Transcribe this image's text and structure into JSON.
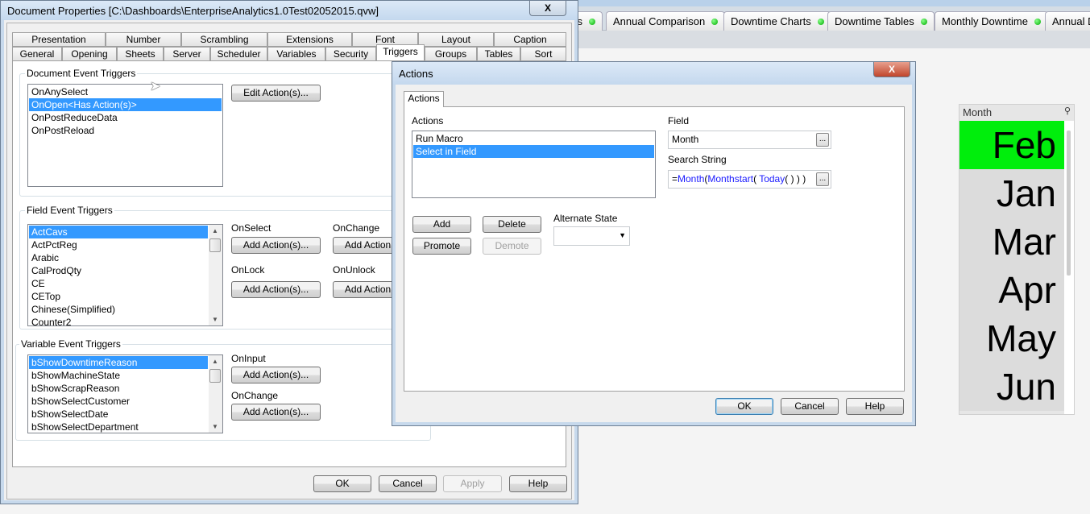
{
  "app": {
    "sheet_tabs": [
      {
        "label": "Annual Comparison"
      },
      {
        "label": "Downtime Charts"
      },
      {
        "label": "Downtime Tables"
      },
      {
        "label": "Monthly Downtime"
      },
      {
        "label": "Annual D"
      }
    ],
    "partial_tab": "s"
  },
  "doc_props": {
    "title": "Document Properties [C:\\Dashboards\\EnterpriseAnalytics1.0Test02052015.qvw]",
    "close": "X",
    "tabs_row1": [
      "Presentation",
      "Number",
      "Scrambling",
      "Extensions",
      "Font",
      "Layout",
      "Caption"
    ],
    "tabs_row2": [
      "General",
      "Opening",
      "Sheets",
      "Server",
      "Scheduler",
      "Variables",
      "Security",
      "Triggers",
      "Groups",
      "Tables",
      "Sort"
    ],
    "selected_tab": "Triggers",
    "document_triggers": {
      "label": "Document Event Triggers",
      "items": [
        "OnAnySelect",
        "OnOpen<Has Action(s)>",
        "OnPostReduceData",
        "OnPostReload"
      ],
      "selected": 1,
      "edit_button": "Edit Action(s)..."
    },
    "field_triggers": {
      "label": "Field Event Triggers",
      "items": [
        "ActCavs",
        "ActPctReg",
        "Arabic",
        "CalProdQty",
        "CE",
        "CETop",
        "Chinese(Simplified)",
        "Counter2"
      ],
      "selected": 0,
      "on_select": "OnSelect",
      "on_change": "OnChange",
      "on_lock": "OnLock",
      "on_unlock": "OnUnlock",
      "add_button": "Add Action(s)..."
    },
    "variable_triggers": {
      "label": "Variable Event Triggers",
      "items": [
        "bShowDowntimeReason",
        "bShowMachineState",
        "bShowScrapReason",
        "bShowSelectCustomer",
        "bShowSelectDate",
        "bShowSelectDepartment"
      ],
      "selected": 0,
      "on_input": "OnInput",
      "on_change": "OnChange",
      "add_button": "Add Action(s)..."
    },
    "buttons": {
      "ok": "OK",
      "cancel": "Cancel",
      "apply": "Apply",
      "help": "Help"
    }
  },
  "actions_dialog": {
    "title": "Actions",
    "close": "X",
    "tab": "Actions",
    "actions_label": "Actions",
    "actions": [
      "Run Macro",
      "Select in Field"
    ],
    "selected": 1,
    "field_label": "Field",
    "field_value": "Month",
    "search_label": "Search String",
    "search_parts": {
      "eq": "=",
      "f1": "Month",
      "p1": "(",
      "f2": "Monthstart",
      "p2": "( ",
      "f3": "Today",
      "p3": "( ) ) )"
    },
    "ellipsis": "...",
    "add": "Add",
    "delete": "Delete",
    "promote": "Promote",
    "demote": "Demote",
    "alt_state_label": "Alternate State",
    "alt_state_value": "",
    "ok": "OK",
    "cancel": "Cancel",
    "help": "Help"
  },
  "listbox": {
    "title": "Month",
    "items": [
      "Feb",
      "Jan",
      "Mar",
      "Apr",
      "May",
      "Jun"
    ],
    "selected": "Feb",
    "selected_color": "#00ee0c"
  }
}
